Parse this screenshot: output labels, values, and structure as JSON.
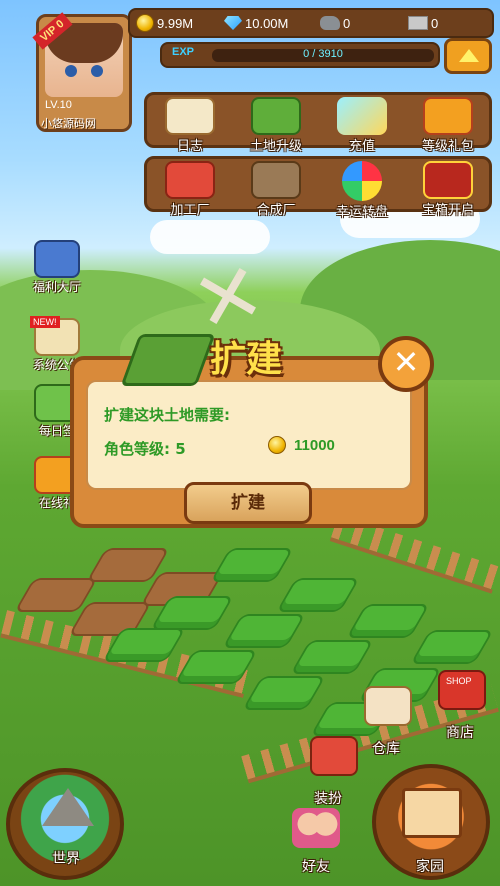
{
  "resources": {
    "gold": "9.99M",
    "gems": "10.00M",
    "stone": "0",
    "wood": "0"
  },
  "exp": {
    "label": "EXP",
    "text": "0 / 3910",
    "progress": 0
  },
  "player": {
    "vip": "VIP 0",
    "level": "LV.10",
    "name": "小悠源码网"
  },
  "menu_row1": [
    {
      "label": "日志",
      "icon": "journal-book-icon"
    },
    {
      "label": "土地升级",
      "icon": "land-upgrade-icon"
    },
    {
      "label": "充值",
      "icon": "crystal-icon"
    },
    {
      "label": "等级礼包",
      "icon": "gift-box-icon"
    }
  ],
  "menu_row2": [
    {
      "label": "加工厂",
      "icon": "factory-icon"
    },
    {
      "label": "合成厂",
      "icon": "workshop-icon"
    },
    {
      "label": "幸运转盘",
      "icon": "lucky-wheel-icon"
    },
    {
      "label": "宝箱开启",
      "icon": "treasure-chest-icon"
    }
  ],
  "side_menu": [
    {
      "label": "福利大厅",
      "icon": "welfare-house-icon"
    },
    {
      "label": "系统公告",
      "icon": "announcement-scroll-icon",
      "badge": "NEW!"
    },
    {
      "label": "每日签",
      "icon": "daily-signin-icon"
    },
    {
      "label": "在线礼",
      "icon": "online-gift-icon"
    }
  ],
  "dialog": {
    "title": "扩建",
    "prompt": "扩建这块土地需要:",
    "level_label": "角色等级: 5",
    "cost": "11000",
    "confirm": "扩建",
    "close": "✕"
  },
  "bottom": {
    "world": "世界",
    "home": "家园",
    "friends": "好友",
    "dress": "装扮",
    "warehouse": "仓库",
    "shop": "商店",
    "shop_sign": "SHOP"
  },
  "colors": {
    "panel": "#8a5328",
    "text_green": "#2e9a26",
    "title_gold": "#ffe14a"
  }
}
